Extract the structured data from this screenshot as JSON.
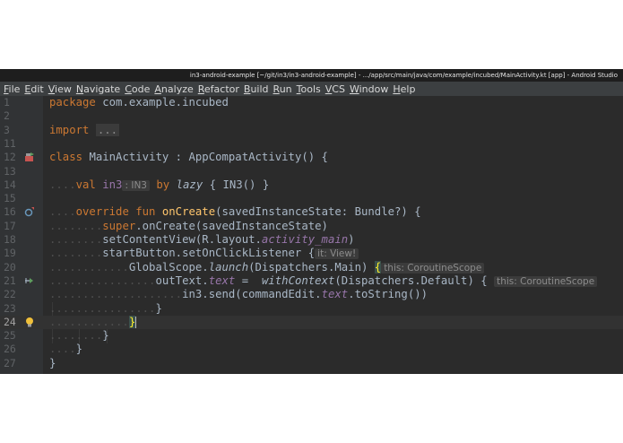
{
  "window": {
    "title": "in3-android-example [~/git/in3/in3-android-example] - .../app/src/main/java/com/example/incubed/MainActivity.kt [app] - Android Studio"
  },
  "menu": [
    "File",
    "Edit",
    "View",
    "Navigate",
    "Code",
    "Analyze",
    "Refactor",
    "Build",
    "Run",
    "Tools",
    "VCS",
    "Window",
    "Help"
  ],
  "editor": {
    "current_line": 24,
    "lines": [
      {
        "n": "1",
        "t": "package com.example.incubed"
      },
      {
        "n": "2",
        "t": ""
      },
      {
        "n": "3",
        "t": "import ..."
      },
      {
        "n": "11",
        "t": ""
      },
      {
        "n": "12",
        "t": "class MainActivity : AppCompatActivity() {"
      },
      {
        "n": "13",
        "t": ""
      },
      {
        "n": "14",
        "t": "val in3: IN3 by lazy { IN3() }"
      },
      {
        "n": "15",
        "t": ""
      },
      {
        "n": "16",
        "t": "override fun onCreate(savedInstanceState: Bundle?) {"
      },
      {
        "n": "17",
        "t": "super.onCreate(savedInstanceState)"
      },
      {
        "n": "18",
        "t": "setContentView(R.layout.activity_main)"
      },
      {
        "n": "19",
        "t": "startButton.setOnClickListener { it: View!"
      },
      {
        "n": "20",
        "t": "GlobalScope.launch(Dispatchers.Main) { this: CoroutineScope"
      },
      {
        "n": "21",
        "t": "outText.text = withContext(Dispatchers.Default) { this: CoroutineScope"
      },
      {
        "n": "22",
        "t": "in3.send(commandEdit.text.toString())"
      },
      {
        "n": "23",
        "t": "}"
      },
      {
        "n": "24",
        "t": "}"
      },
      {
        "n": "25",
        "t": "}"
      },
      {
        "n": "26",
        "t": "}"
      },
      {
        "n": "27",
        "t": "}"
      }
    ],
    "tokens": {
      "l1_kw": "package",
      "l1_pkg": "com.example.incubed",
      "l3_kw": "import",
      "l3_fold": "...",
      "l12_kw": "class",
      "l12_rest": "MainActivity : AppCompatActivity() {",
      "l14_kw": "val",
      "l14_name": "in3",
      "l14_hint": ": IN3",
      "l14_by": "by",
      "l14_lazy": "lazy",
      "l14_rest": "{ IN3() }",
      "l16_kw": "override fun",
      "l16_fn": "onCreate",
      "l16_rest": "(savedInstanceState: Bundle?) {",
      "l17_kw": "super",
      "l17_rest": ".onCreate(savedInstanceState)",
      "l18_a": "setContentView(R.layout.",
      "l18_b": "activity_main",
      "l18_c": ")",
      "l19_a": "startButton.setOnClickListener {",
      "l19_hint": "it: View!",
      "l20_a": "GlobalScope.",
      "l20_b": "launch",
      "l20_c": "(Dispatchers.Main)",
      "l20_brace": "{",
      "l20_hint": "this: CoroutineScope",
      "l21_a": "outText.",
      "l21_b": "text",
      "l21_c": " =  ",
      "l21_d": "withContext",
      "l21_e": "(Dispatchers.Default) {",
      "l21_hint": "this: CoroutineScope",
      "l22_a": "in3.send(commandEdit.",
      "l22_b": "text",
      "l22_c": ".toString())",
      "brace": "}"
    },
    "gutter_icons": {
      "12": "run-class-icon",
      "16": "override-method-icon",
      "21": "suspend-call-icon",
      "24": "intention-bulb-icon"
    },
    "colors": {
      "background": "#2b2b2b",
      "keyword": "#cc7832",
      "function": "#ffc66d",
      "property": "#9876aa",
      "text": "#a9b7c6",
      "hint": "#8c8c8c"
    }
  }
}
